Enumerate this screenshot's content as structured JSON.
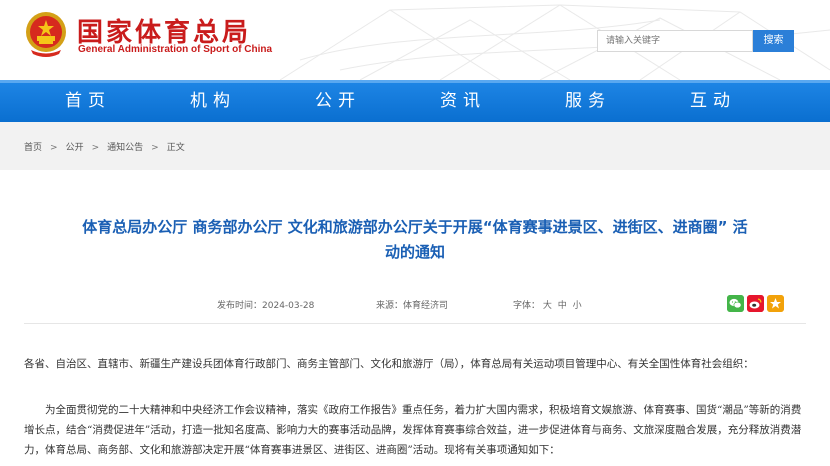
{
  "site": {
    "title_cn": "国家体育总局",
    "title_en": "General Administration of Sport of China"
  },
  "search": {
    "placeholder": "请输入关键字",
    "button_label": "搜索"
  },
  "nav": {
    "items": [
      {
        "label": "首页"
      },
      {
        "label": "机构"
      },
      {
        "label": "公开"
      },
      {
        "label": "资讯"
      },
      {
        "label": "服务"
      },
      {
        "label": "互动"
      }
    ]
  },
  "breadcrumb": {
    "items": [
      "首页",
      "公开",
      "通知公告",
      "正文"
    ],
    "separator": ">"
  },
  "article": {
    "title_line1": "体育总局办公厅 商务部办公厅 文化和旅游部办公厅关于开展“体育赛事进景区、进街区、进商圈” 活",
    "title_line2": "动的通知",
    "publish_label": "发布时间：",
    "publish_date": "2024-03-28",
    "source_label": "来源：",
    "source": "体育经济司",
    "font_label": "字体：",
    "font_large": "大",
    "font_medium": "中",
    "font_small": "小",
    "paragraph1": "各省、自治区、直辖市、新疆生产建设兵团体育行政部门、商务主管部门、文化和旅游厅（局），体育总局有关运动项目管理中心、有关全国性体育社会组织：",
    "paragraph2": "为全面贯彻党的二十大精神和中央经济工作会议精神，落实《政府工作报告》重点任务，着力扩大国内需求，积极培育文娱旅游、体育赛事、国货“潮品”等新的消费增长点，结合“消费促进年”活动，打造一批知名度高、影响力大的赛事活动品牌，发挥体育赛事综合效益，进一步促进体育与商务、文旅深度融合发展，充分释放消费潜力，体育总局、商务部、文化和旅游部决定开展“体育赛事进景区、进街区、进商圈”活动。现将有关事项通知如下："
  },
  "icons": {
    "logo": "national-emblem-icon",
    "share": [
      "wechat-icon",
      "weibo-icon",
      "favorite-star-icon"
    ]
  },
  "colors": {
    "brand_red": "#c91c1c",
    "nav_blue": "#0a6fd0",
    "title_blue": "#1a5fb4",
    "search_button": "#2b7fd8"
  }
}
